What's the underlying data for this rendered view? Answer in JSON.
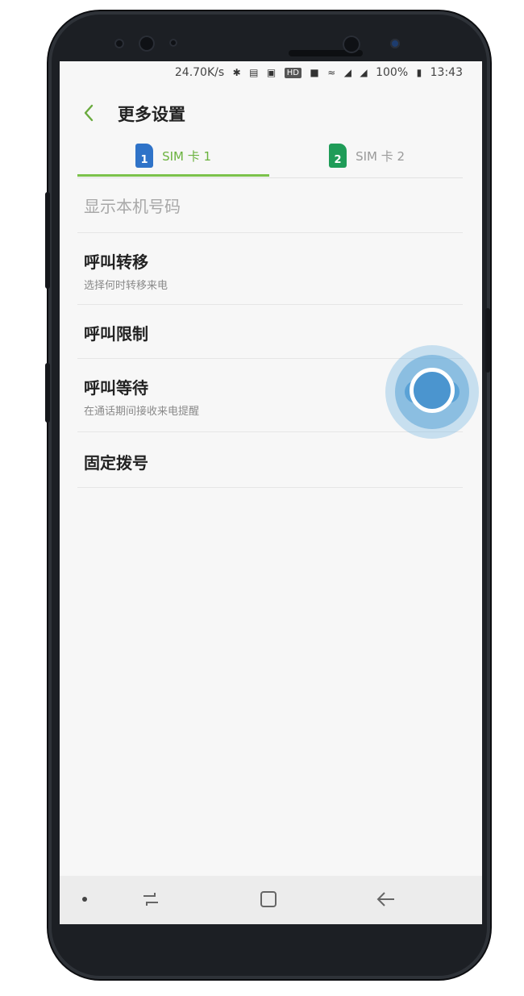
{
  "status_bar": {
    "network_speed": "24.70K/s",
    "icons": [
      "bluetooth-icon",
      "nfc-icon",
      "notification-icon",
      "hd-icon",
      "app-icon",
      "wifi-icon",
      "no-sim-icon",
      "signal-icon"
    ],
    "hd_label": "HD",
    "battery": "100%",
    "time": "13:43"
  },
  "header": {
    "back_icon": "chevron-left-icon",
    "title": "更多设置"
  },
  "tabs": [
    {
      "badge": "1",
      "label": "SIM 卡 1",
      "selected": true,
      "color": "#2f73c8"
    },
    {
      "badge": "2",
      "label": "SIM 卡 2",
      "selected": false,
      "color": "#1f9c58"
    }
  ],
  "settings": [
    {
      "title": "显示本机号码",
      "subtitle": "",
      "enabled": false
    },
    {
      "title": "呼叫转移",
      "subtitle": "选择何时转移来电",
      "enabled": true
    },
    {
      "title": "呼叫限制",
      "subtitle": "",
      "enabled": true
    },
    {
      "title": "呼叫等待",
      "subtitle": "在通话期间接收来电提醒",
      "enabled": true,
      "toggle_on": true
    },
    {
      "title": "固定拨号",
      "subtitle": "",
      "enabled": true
    }
  ],
  "navigation": {
    "items": [
      "dot-indicator-icon",
      "recent-apps-icon",
      "home-icon",
      "back-arrow-icon"
    ]
  },
  "colors": {
    "accent_green": "#7cc24c",
    "toggle_blue": "#4b95cf"
  }
}
